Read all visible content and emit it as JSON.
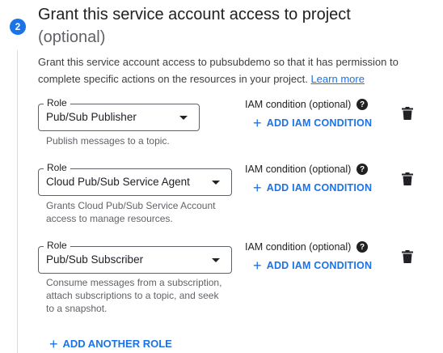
{
  "step": {
    "number": "2"
  },
  "header": {
    "title": "Grant this service account access to project",
    "optional": "(optional)"
  },
  "description": {
    "text": "Grant this service account access to pubsubdemo so that it has permission to complete specific actions on the resources in your project. ",
    "link": "Learn more"
  },
  "roles": [
    {
      "label": "Role",
      "value": "Pub/Sub Publisher",
      "hint": "Publish messages to a topic.",
      "iam_label": "IAM condition (optional)",
      "add_condition": "ADD IAM CONDITION"
    },
    {
      "label": "Role",
      "value": "Cloud Pub/Sub Service Agent",
      "hint": "Grants Cloud Pub/Sub Service Account access to manage resources.",
      "iam_label": "IAM condition (optional)",
      "add_condition": "ADD IAM CONDITION"
    },
    {
      "label": "Role",
      "value": "Pub/Sub Subscriber",
      "hint": "Consume messages from a subscription, attach subscriptions to a topic, and seek to a snapshot.",
      "iam_label": "IAM condition (optional)",
      "add_condition": "ADD IAM CONDITION"
    }
  ],
  "add_another_role": "ADD ANOTHER ROLE",
  "icons": {
    "help": "help-circle-icon",
    "delete": "trash-icon",
    "add": "plus-icon",
    "dropdown": "caret-down-icon"
  },
  "colors": {
    "accent": "#1a73e8",
    "text": "#202124",
    "muted": "#5f6368"
  }
}
